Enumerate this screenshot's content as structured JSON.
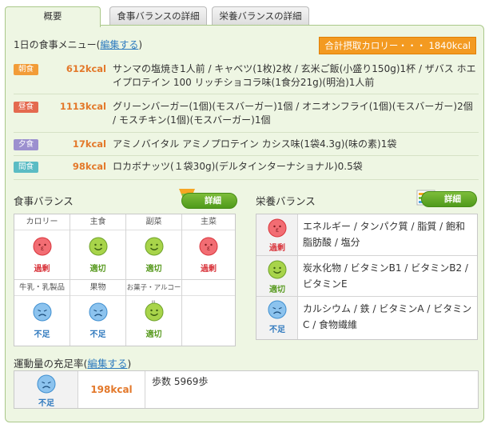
{
  "tabs": [
    {
      "label": "概要",
      "active": true
    },
    {
      "label": "食事バランスの詳細",
      "active": false
    },
    {
      "label": "栄養バランスの詳細",
      "active": false
    }
  ],
  "menu": {
    "title": "1日の食事メニュー(",
    "edit_link": "編集する",
    "title_close": ")",
    "total_calorie": "合計摂取カロリー・・・ 1840kcal",
    "meals": [
      {
        "tag": "朝食",
        "kcal": "612kcal",
        "desc": "サンマの塩焼き1人前 / キャベツ(1枚)2枚 / 玄米ご飯(小盛り150g)1杯 / ザバス ホエイプロテイン 100 リッチショコラ味(1食分21g)(明治)1人前"
      },
      {
        "tag": "昼食",
        "kcal": "1113kcal",
        "desc": "グリーンバーガー(1個)(モスバーガー)1個 / オニオンフライ(1個)(モスバーガー)2個 / モスチキン(1個)(モスバーガー)1個"
      },
      {
        "tag": "夕食",
        "kcal": "17kcal",
        "desc": "アミノバイタル アミノプロテイン カシス味(1袋4.3g)(味の素)1袋"
      },
      {
        "tag": "間食",
        "kcal": "98kcal",
        "desc": "ロカボナッツ(１袋30g)(デルタインターナショナル)0.5袋"
      }
    ]
  },
  "food_balance": {
    "title": "食事バランス",
    "detail_label": "詳細",
    "cells": [
      {
        "head": "カロリー",
        "status": "過剰",
        "state": "over"
      },
      {
        "head": "主食",
        "status": "適切",
        "state": "ok"
      },
      {
        "head": "副菜",
        "status": "適切",
        "state": "ok"
      },
      {
        "head": "主菜",
        "status": "過剰",
        "state": "over"
      },
      {
        "head": "牛乳・乳製品",
        "status": "不足",
        "state": "low"
      },
      {
        "head": "果物",
        "status": "不足",
        "state": "low"
      },
      {
        "head": "お菓子・アルコール",
        "status": "適切",
        "state": "ok"
      },
      {
        "head": "",
        "status": "",
        "state": "empty"
      }
    ]
  },
  "nutrition_balance": {
    "title": "栄養バランス",
    "detail_label": "詳細",
    "rows": [
      {
        "status": "過剰",
        "state": "over",
        "text": "エネルギー / タンパク質 / 脂質 / 飽和脂肪酸 / 塩分"
      },
      {
        "status": "適切",
        "state": "ok",
        "text": "炭水化物 / ビタミンB1 / ビタミンB2 / ビタミンE"
      },
      {
        "status": "不足",
        "state": "low",
        "text": "カルシウム / 鉄 / ビタミンA / ビタミンC / 食物繊維"
      }
    ]
  },
  "exercise": {
    "title": "運動量の充足率(",
    "edit_link": "編集する",
    "title_close": ")",
    "status": "不足",
    "kcal": "198kcal",
    "steps": "歩数 5969歩"
  },
  "colors": {
    "accent_orange": "#f39a21",
    "over_red": "#d9353c",
    "ok_green": "#5a9b22",
    "low_blue": "#2f79be",
    "panel_bg": "#eef6e3"
  }
}
